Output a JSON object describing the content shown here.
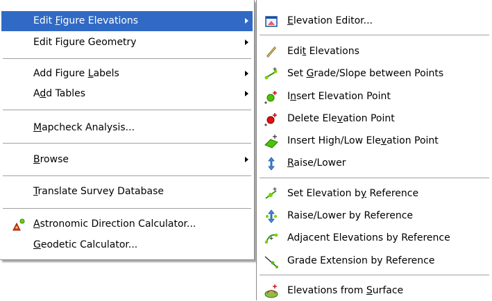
{
  "left_menu": {
    "items": [
      {
        "pre": "Edit ",
        "acc": "F",
        "post": "igure Elevations",
        "submenu": true,
        "highlight": true
      },
      {
        "pre": "Edit Fi",
        "acc": "g",
        "post": "ure Geometry",
        "submenu": true
      },
      {
        "pre": "Add Figure ",
        "acc": "L",
        "post": "abels",
        "submenu": true
      },
      {
        "pre": "A",
        "acc": "d",
        "post": "d Tables",
        "submenu": true
      },
      {
        "pre": "",
        "acc": "M",
        "post": "apcheck Analysis...",
        "submenu": false
      },
      {
        "pre": "",
        "acc": "B",
        "post": "rowse",
        "submenu": true
      },
      {
        "pre": "",
        "acc": "T",
        "post": "ranslate Survey Database",
        "submenu": false
      },
      {
        "pre": "",
        "acc": "A",
        "post": "stronomic Direction Calculator...",
        "submenu": false,
        "icon": "astronomic-calculator-icon"
      },
      {
        "pre": "",
        "acc": "G",
        "post": "eodetic Calculator...",
        "submenu": false
      }
    ]
  },
  "right_menu": {
    "items": [
      {
        "pre": "",
        "acc": "E",
        "post": "levation Editor...",
        "icon": "elevation-editor-icon"
      },
      {
        "pre": "Edi",
        "acc": "t",
        "post": " Elevations",
        "icon": "edit-elevations-icon"
      },
      {
        "pre": "Set ",
        "acc": "G",
        "post": "rade/Slope between Points",
        "icon": "set-grade-slope-icon"
      },
      {
        "pre": "I",
        "acc": "n",
        "post": "sert Elevation Point",
        "icon": "insert-elevation-point-icon"
      },
      {
        "pre": "Delete Ele",
        "acc": "v",
        "post": "ation Point",
        "icon": "delete-elevation-point-icon"
      },
      {
        "pre": "Insert High/Low Ele",
        "acc": "v",
        "post": "ation Point",
        "icon": "insert-high-low-icon"
      },
      {
        "pre": "",
        "acc": "R",
        "post": "aise/Lower",
        "icon": "raise-lower-icon"
      },
      {
        "pre": "Set Elevation b",
        "acc": "y",
        "post": " Reference",
        "icon": "set-elevation-reference-icon"
      },
      {
        "pre": "Raise/Lower by Reference",
        "acc": "",
        "post": "",
        "icon": "raise-lower-reference-icon"
      },
      {
        "pre": "Adjacent Elevations by Reference",
        "acc": "",
        "post": "",
        "icon": "adjacent-elevations-icon"
      },
      {
        "pre": "Grade Extension by Reference",
        "acc": "",
        "post": "",
        "icon": "grade-extension-icon"
      },
      {
        "pre": "Elevations from ",
        "acc": "S",
        "post": "urface",
        "icon": "elevations-from-surface-icon"
      }
    ]
  },
  "colors": {
    "highlight": "#316ac5",
    "separator": "#a0a0a0"
  }
}
